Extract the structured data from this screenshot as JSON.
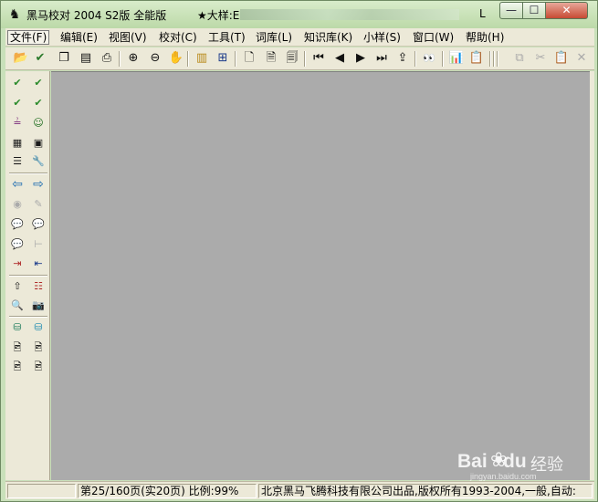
{
  "window": {
    "app_icon": "horse-logo-icon",
    "title": "黑马校对 2004  S2版  全能版",
    "document_prefix": "★大样:E",
    "document_trail": "L",
    "min_glyph": "—",
    "max_glyph": "☐",
    "close_glyph": "✕"
  },
  "menu": [
    {
      "label": "文件(F)",
      "name": "menu-file"
    },
    {
      "label": "编辑(E)",
      "name": "menu-edit"
    },
    {
      "label": "视图(V)",
      "name": "menu-view"
    },
    {
      "label": "校对(C)",
      "name": "menu-proof"
    },
    {
      "label": "工具(T)",
      "name": "menu-tools"
    },
    {
      "label": "词库(L)",
      "name": "menu-lexicon"
    },
    {
      "label": "知识库(K)",
      "name": "menu-knowledge"
    },
    {
      "label": "小样(S)",
      "name": "menu-sample"
    },
    {
      "label": "窗口(W)",
      "name": "menu-window"
    },
    {
      "label": "帮助(H)",
      "name": "menu-help"
    }
  ],
  "toolbar": [
    {
      "name": "open-icon",
      "glyph": "📂"
    },
    {
      "name": "proof-check-icon",
      "glyph": "✔"
    },
    {
      "name": "copy-pages-icon",
      "glyph": "❐"
    },
    {
      "name": "page-list-icon",
      "glyph": "▤"
    },
    {
      "name": "print-icon",
      "glyph": "⎙"
    },
    {
      "name": "zoom-in-icon",
      "glyph": "⊕"
    },
    {
      "name": "zoom-out-icon",
      "glyph": "⊖"
    },
    {
      "name": "hand-icon",
      "glyph": "✋"
    },
    {
      "name": "single-page-view-icon",
      "glyph": "▥"
    },
    {
      "name": "grid-view-icon",
      "glyph": "⊞"
    },
    {
      "name": "page-icon",
      "glyph": "🗋"
    },
    {
      "name": "page-text-icon",
      "glyph": "🗎"
    },
    {
      "name": "page-columns-icon",
      "glyph": "🗐"
    },
    {
      "name": "first-page-icon",
      "glyph": "⏮"
    },
    {
      "name": "prev-page-icon",
      "glyph": "◀"
    },
    {
      "name": "next-page-icon",
      "glyph": "▶"
    },
    {
      "name": "last-page-icon",
      "glyph": "⏭"
    },
    {
      "name": "export-icon",
      "glyph": "⇪"
    },
    {
      "name": "find-binoculars-icon",
      "glyph": "👀"
    },
    {
      "name": "statistics-chart-icon",
      "glyph": "📊"
    },
    {
      "name": "properties-icon",
      "glyph": "📋"
    },
    {
      "name": "copy-icon",
      "glyph": "⧉"
    },
    {
      "name": "cut-icon",
      "glyph": "✂"
    },
    {
      "name": "paste-icon",
      "glyph": "📋"
    },
    {
      "name": "delete-icon",
      "glyph": "✕"
    }
  ],
  "side_toolbar": [
    {
      "name": "abc-check-icon",
      "glyph": "✔"
    },
    {
      "name": "abc-check-all-icon",
      "glyph": "✔"
    },
    {
      "name": "number-check-icon",
      "glyph": "✔"
    },
    {
      "name": "kg-unit-check-icon",
      "glyph": "✔"
    },
    {
      "name": "abc-compare-icon",
      "glyph": "≟"
    },
    {
      "name": "portrait-icon",
      "glyph": "☺"
    },
    {
      "name": "table-grid-icon",
      "glyph": "▦"
    },
    {
      "name": "monitor-icon",
      "glyph": "▣"
    },
    {
      "name": "list-check-icon",
      "glyph": "☰"
    },
    {
      "name": "wrench-icon",
      "glyph": "🔧"
    },
    {
      "name": "back-arrow-icon",
      "glyph": "⇦"
    },
    {
      "name": "forward-arrow-icon",
      "glyph": "⇨"
    },
    {
      "name": "eye-icon",
      "glyph": "◉"
    },
    {
      "name": "pen-icon",
      "glyph": "✎"
    },
    {
      "name": "comment-pink-icon",
      "glyph": "💬"
    },
    {
      "name": "comment-purple-icon",
      "glyph": "💬"
    },
    {
      "name": "comment-red-icon",
      "glyph": "💬"
    },
    {
      "name": "bridge-icon",
      "glyph": "⊢"
    },
    {
      "name": "insert-left-icon",
      "glyph": "⇥"
    },
    {
      "name": "insert-right-icon",
      "glyph": "⇤"
    },
    {
      "name": "upload-icon",
      "glyph": "⇧"
    },
    {
      "name": "numbered-list-icon",
      "glyph": "☷"
    },
    {
      "name": "image-search-icon",
      "glyph": "🔍"
    },
    {
      "name": "camera-icon",
      "glyph": "📷"
    },
    {
      "name": "db-add-icon",
      "glyph": "⛁"
    },
    {
      "name": "db-blue-icon",
      "glyph": "⛁"
    },
    {
      "name": "image-check-icon",
      "glyph": "🖻"
    },
    {
      "name": "image-check-2-icon",
      "glyph": "🖻"
    },
    {
      "name": "image-check-3-icon",
      "glyph": "🖻"
    },
    {
      "name": "image-check-4-icon",
      "glyph": "🖻"
    }
  ],
  "status": {
    "page_info": "第25/160页(实20页) 比例:99%",
    "copyright": "北京黑马飞腾科技有限公司出品,版权所有1993-2004,一般,自动:"
  },
  "watermark": {
    "logo": "Bai",
    "logo_tail": "du",
    "chinese": "经验",
    "url": "jingyan.baidu.com"
  }
}
